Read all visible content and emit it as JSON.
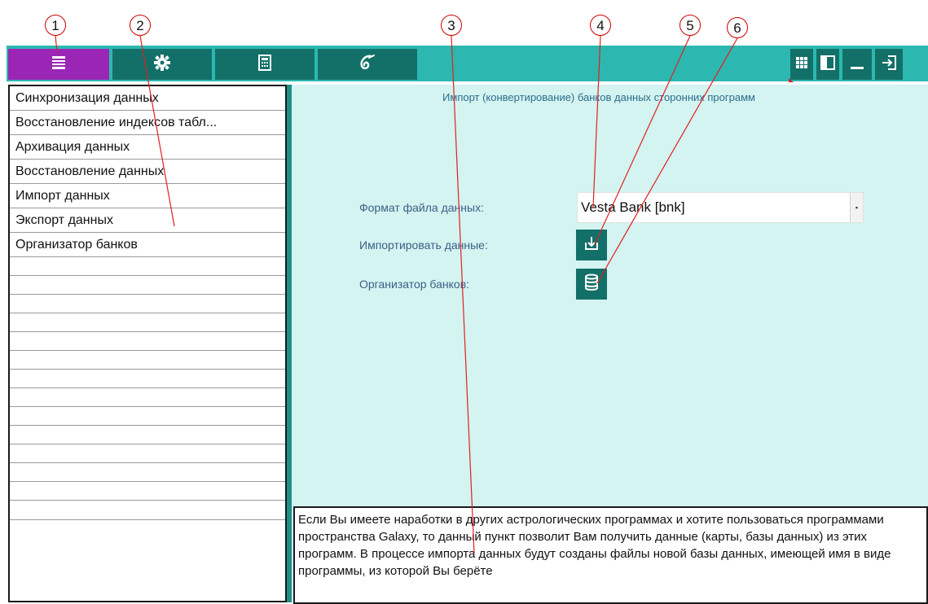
{
  "callouts": [
    "1",
    "2",
    "3",
    "4",
    "5",
    "6"
  ],
  "toolbar": {
    "left_buttons": [
      {
        "icon": "list-icon",
        "active": true
      },
      {
        "icon": "gear-icon"
      },
      {
        "icon": "calculator-icon"
      },
      {
        "icon": "galaxy-logo-icon"
      }
    ],
    "right_buttons": [
      {
        "icon": "grid-icon"
      },
      {
        "icon": "panel-icon"
      },
      {
        "icon": "minimize-icon"
      },
      {
        "icon": "exit-icon"
      }
    ],
    "colors": {
      "bar": "#2cb8b0",
      "active": "#9b26b6",
      "dark": "#137068"
    }
  },
  "sidebar": {
    "items": [
      "Синхронизация данных",
      "Восстановление индексов табл...",
      "Архивация данных",
      "Восстановление данных",
      "Импорт данных",
      "Экспорт данных",
      "Организатор банков"
    ],
    "empty_rows": 14
  },
  "main": {
    "title": "Импорт (конвертирование) банков данных сторонних программ",
    "format_label": "Формат файла данных:",
    "format_value": "Vesta Bank [bnk]",
    "import_label": "Импортировать данные:",
    "organizer_label": "Организатор банков:",
    "info_text": "Если Вы имеете наработки в других астрологических программах и хотите пользоваться программами пространства Galaxy, то данный пункт позволит Вам получить данные (карты, базы данных) из этих программ. В процессе импорта данных будут созданы файлы новой базы данных, имеющей имя в виде программы, из которой Вы берёте"
  }
}
